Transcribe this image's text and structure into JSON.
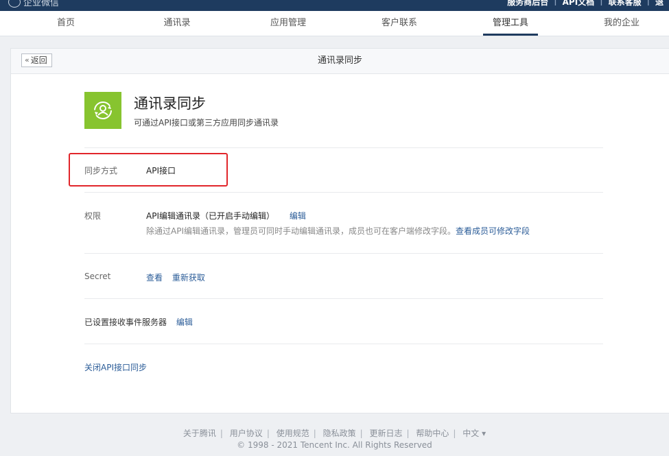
{
  "topbar": {
    "brand": "企业微信",
    "links": [
      "服务商后台",
      "API文档",
      "联系客服",
      "退"
    ]
  },
  "nav": {
    "items": [
      "首页",
      "通讯录",
      "应用管理",
      "客户联系",
      "管理工具",
      "我的企业"
    ],
    "active_index": 4
  },
  "panel": {
    "back_label": "返回",
    "title": "通讯录同步"
  },
  "app": {
    "title": "通讯录同步",
    "desc": "可通过API接口或第三方应用同步通讯录",
    "icon": "contact-sync-icon",
    "icon_color": "#87c42f"
  },
  "sync_mode": {
    "label": "同步方式",
    "value": "API接口"
  },
  "permission": {
    "label": "权限",
    "value": "API编辑通讯录（已开启手动编辑）",
    "edit_link": "编辑",
    "hint": "除通过API编辑通讯录，管理员可同时手动编辑通讯录，成员也可在客户端修改字段。",
    "hint_link": "查看成员可修改字段"
  },
  "secret": {
    "label": "Secret",
    "view_link": "查看",
    "refresh_link": "重新获取"
  },
  "event_server": {
    "label": "已设置接收事件服务器",
    "edit_link": "编辑"
  },
  "close_link": "关闭API接口同步",
  "footer": {
    "links": [
      "关于腾讯",
      "用户协议",
      "使用规范",
      "隐私政策",
      "更新日志",
      "帮助中心",
      "中文 ▾"
    ],
    "copyright": "© 1998 - 2021 Tencent Inc. All Rights Reserved"
  },
  "colors": {
    "topbar": "#1e3b5f",
    "link": "#2b5c98",
    "highlight": "#e1252a"
  }
}
